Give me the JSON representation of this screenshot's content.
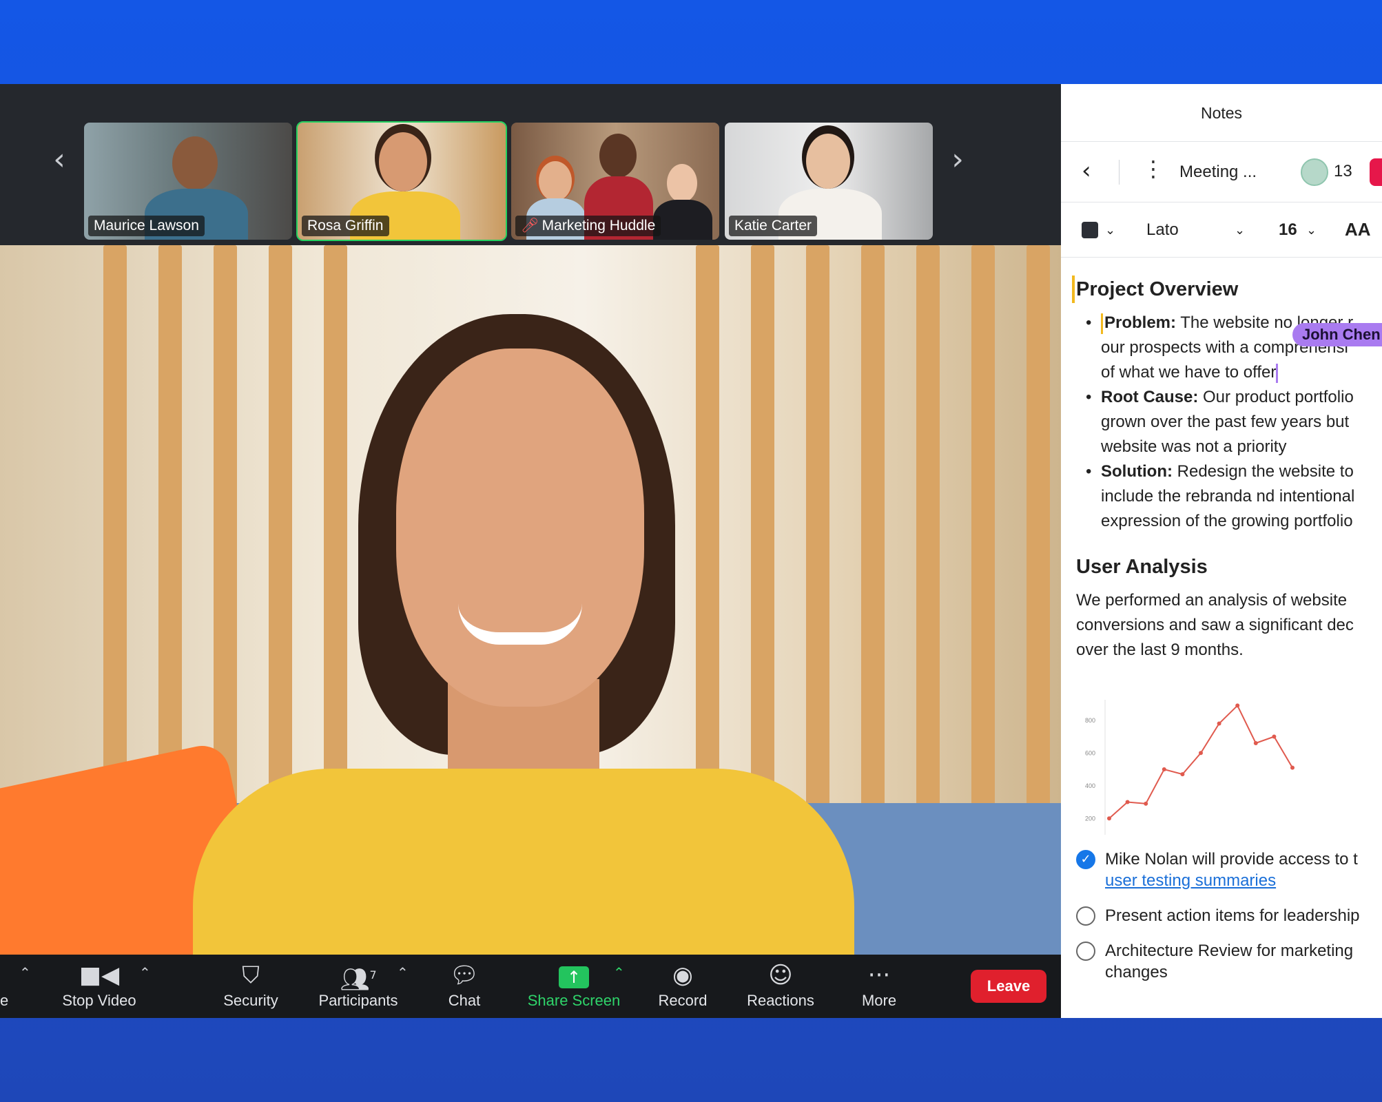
{
  "thumbnails": [
    {
      "name": "Maurice Lawson",
      "muted": false,
      "active": false
    },
    {
      "name": "Rosa Griffin",
      "muted": false,
      "active": true
    },
    {
      "name": "Marketing Huddle",
      "muted": true,
      "active": false
    },
    {
      "name": "Katie Carter",
      "muted": false,
      "active": false
    }
  ],
  "toolbar": {
    "stop_video": "Stop Video",
    "security": "Security",
    "participants": "Participants",
    "participant_count": "7",
    "chat": "Chat",
    "share_screen": "Share Screen",
    "record": "Record",
    "reactions": "Reactions",
    "more": "More",
    "leave": "Leave",
    "partial_left": "e"
  },
  "notes": {
    "panel_title": "Notes",
    "doc_name": "Meeting ...",
    "viewer_count": "13",
    "font": "Lato",
    "font_size": "16",
    "case_label": "AA",
    "collaborator": "John Chen",
    "section1": {
      "title": "Project Overview",
      "bullets": [
        {
          "label": "Problem:",
          "lines": [
            "The website no longer r",
            "our prospects with a comprehensi",
            "of what we have to offer"
          ]
        },
        {
          "label": "Root Cause:",
          "lines": [
            "Our product portfolio",
            "grown over the past few years but",
            "website was not a priority"
          ]
        },
        {
          "label": "Solution:",
          "lines": [
            "Redesign the website to",
            "include the rebranda nd intentional",
            "expression of the growing portfolio"
          ]
        }
      ]
    },
    "section2": {
      "title": "User Analysis",
      "lines": [
        "We performed an analysis of website",
        "conversions and saw a significant dec",
        "over the last 9 months."
      ]
    },
    "tasks": [
      {
        "text": "Mike Nolan will provide access to t",
        "link": "user testing summaries",
        "checked": true
      },
      {
        "text": "Present action items for leadership",
        "checked": false
      },
      {
        "text": "Architecture Review for marketing",
        "text2": "changes",
        "checked": false
      }
    ]
  },
  "chart_data": {
    "type": "line",
    "yticks": [
      "800",
      "600",
      "400",
      "200"
    ],
    "ylim": [
      100,
      900
    ],
    "x": [
      1,
      2,
      3,
      4,
      5,
      6,
      7,
      8,
      9,
      10,
      11
    ],
    "values": [
      200,
      300,
      290,
      500,
      470,
      600,
      780,
      890,
      660,
      700,
      510
    ],
    "color": "#e05a4e"
  }
}
